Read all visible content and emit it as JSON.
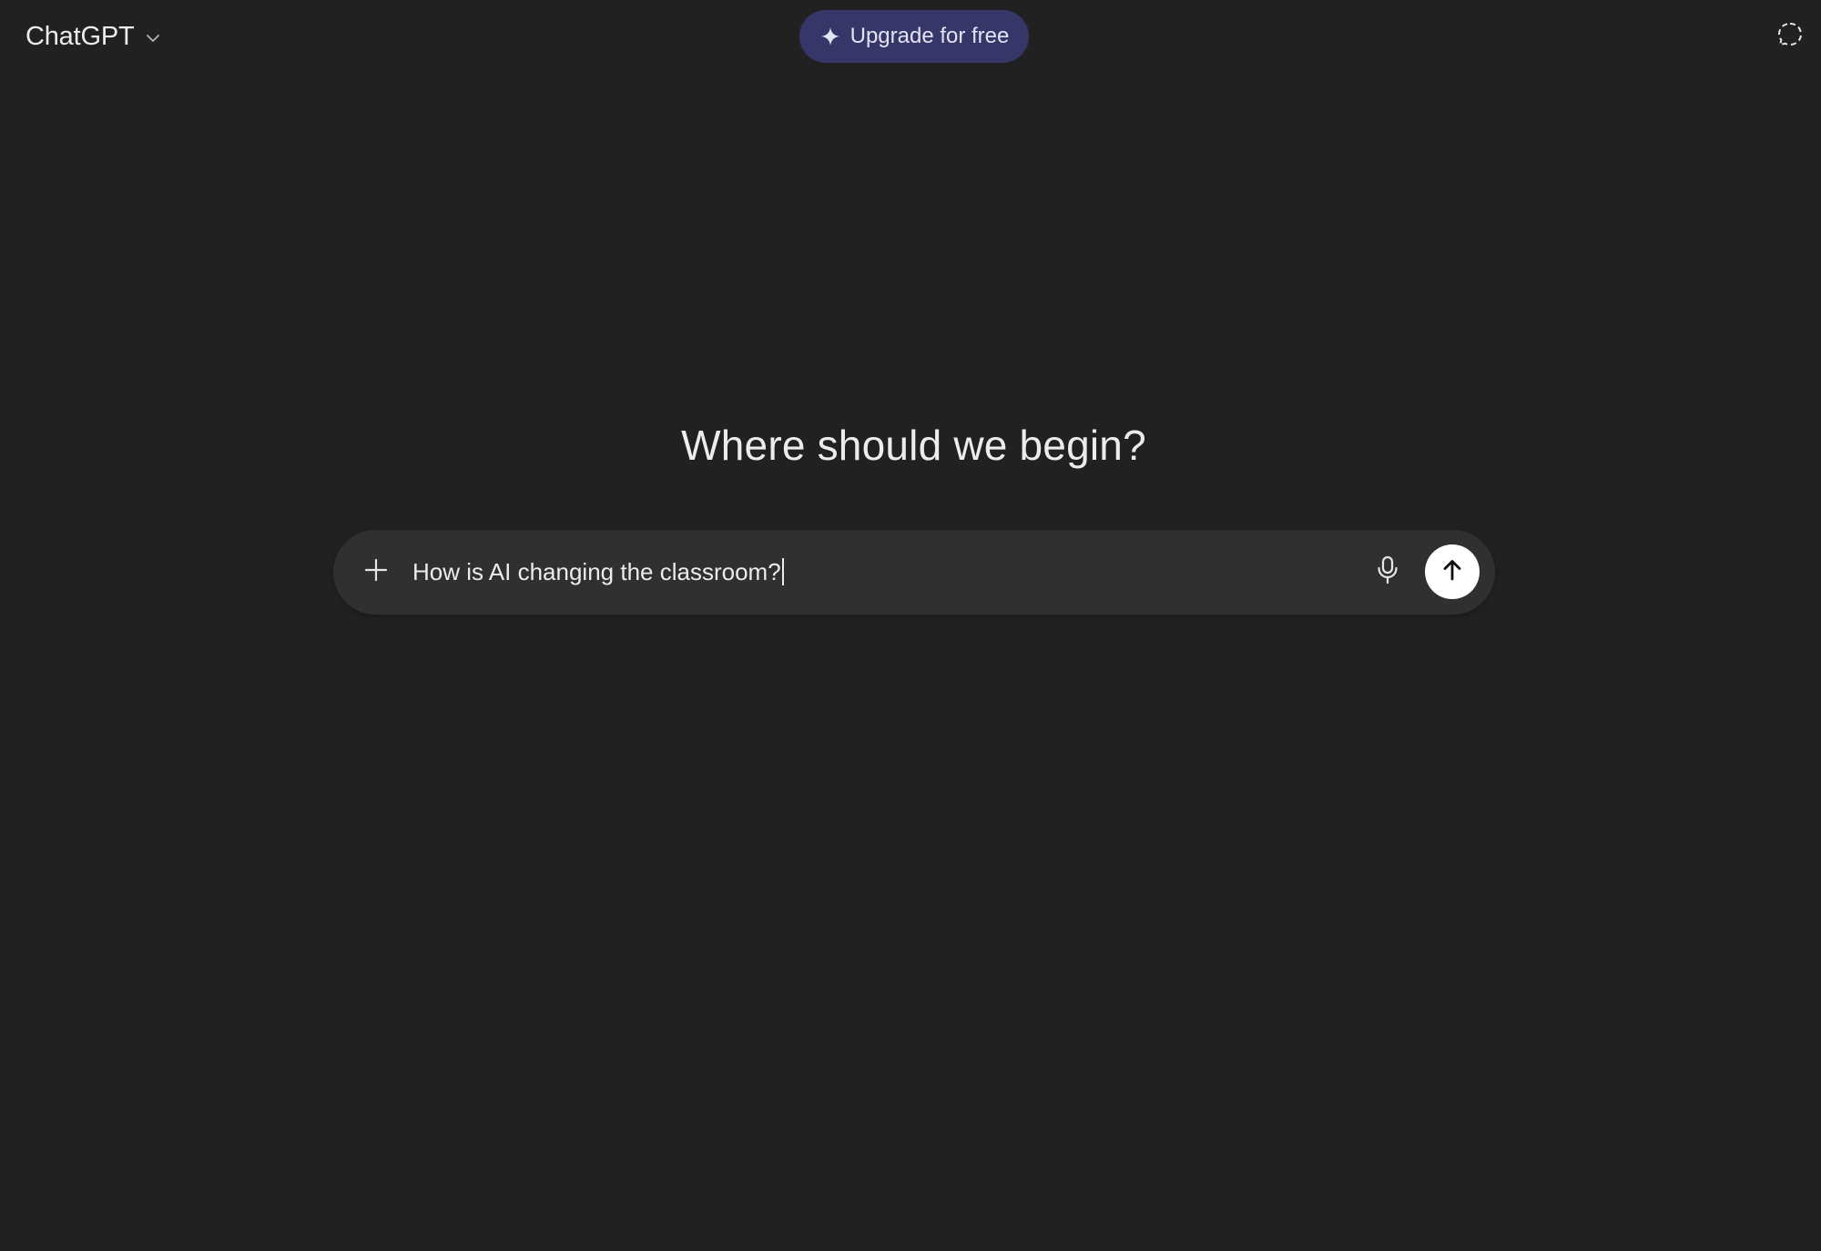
{
  "header": {
    "model_name": "ChatGPT",
    "model_chevron_icon": "chevron-down-icon",
    "upgrade_label": "Upgrade for free",
    "upgrade_icon": "sparkle-icon",
    "upgrade_bg_color": "#373669",
    "temp_chat_icon": "dashed-chat-bubble-icon"
  },
  "main": {
    "headline": "Where should we begin?"
  },
  "composer": {
    "value": "How is AI changing the classroom?",
    "attach_icon": "plus-icon",
    "voice_icon": "microphone-icon",
    "send_icon": "arrow-up-icon",
    "bg_color": "#303030"
  },
  "theme": {
    "background": "#212121",
    "text": "#ececec"
  }
}
